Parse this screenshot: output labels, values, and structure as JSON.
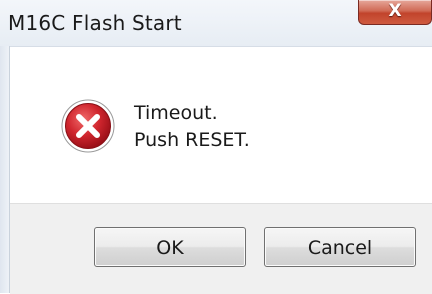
{
  "window": {
    "title": "M16C Flash Start",
    "close_glyph": "X"
  },
  "dialog": {
    "icon": "error-icon",
    "message_line1": "Timeout.",
    "message_line2": "Push RESET."
  },
  "buttons": {
    "ok_label": "OK",
    "cancel_label": "Cancel"
  },
  "colors": {
    "error_red": "#c8202a",
    "close_red": "#c1442c",
    "button_bar": "#f0f0f0"
  }
}
